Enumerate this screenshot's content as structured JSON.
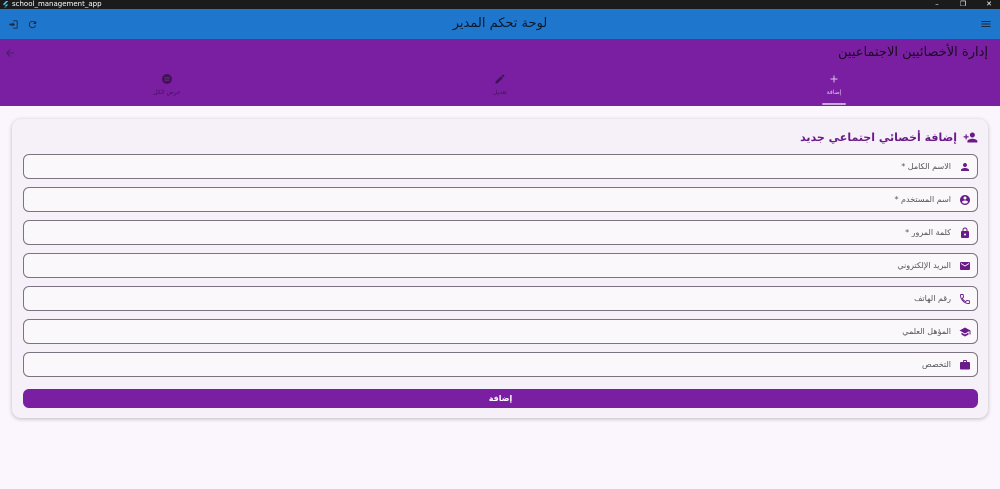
{
  "window": {
    "title": "school_management_app"
  },
  "appbar": {
    "title": "لوحة تحكم المدير"
  },
  "section": {
    "title": "إدارة الأخصائيين الاجتماعيين"
  },
  "tabs": [
    {
      "label": "عرض الكل"
    },
    {
      "label": "تعديل"
    },
    {
      "label": "إضافة"
    }
  ],
  "form": {
    "title": "إضافة أخصائي اجتماعي جديد",
    "fields": [
      {
        "placeholder": "الاسم الكامل *",
        "value": ""
      },
      {
        "placeholder": "اسم المستخدم *",
        "value": ""
      },
      {
        "placeholder": "كلمة المرور *",
        "value": ""
      },
      {
        "placeholder": "البريد الإلكتروني",
        "value": ""
      },
      {
        "placeholder": "رقم الهاتف",
        "value": ""
      },
      {
        "placeholder": "المؤهل العلمي",
        "value": ""
      },
      {
        "placeholder": "التخصص",
        "value": ""
      }
    ],
    "submit_label": "إضافة"
  },
  "colors": {
    "appbar": "#1e76cd",
    "primary": "#7b1fa2",
    "background": "#fbf6fd"
  }
}
